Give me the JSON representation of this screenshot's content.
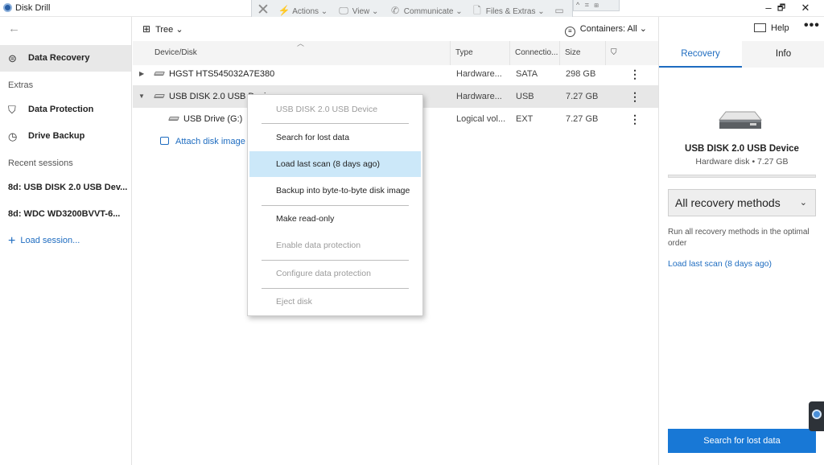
{
  "window": {
    "title": "Disk Drill",
    "controls": {
      "minimize": "–",
      "maximize": "🗗",
      "close": "✕"
    }
  },
  "remote_toolbar": {
    "items": [
      {
        "label": "Actions",
        "icon": "lightning-icon"
      },
      {
        "label": "View",
        "icon": "monitor-icon"
      },
      {
        "label": "Communicate",
        "icon": "phone-icon"
      },
      {
        "label": "Files & Extras",
        "icon": "files-icon"
      }
    ]
  },
  "sidebar": {
    "primary": {
      "label": "Data Recovery",
      "icon": "disk-icon"
    },
    "extras_label": "Extras",
    "extras": [
      {
        "label": "Data Protection",
        "icon": "shield-icon"
      },
      {
        "label": "Drive Backup",
        "icon": "clock-icon"
      }
    ],
    "recent_label": "Recent sessions",
    "sessions": [
      {
        "label": "8d: USB DISK 2.0 USB Dev..."
      },
      {
        "label": "8d: WDC WD3200BVVT-6..."
      }
    ],
    "load_session": "Load session..."
  },
  "toolbar": {
    "view_mode": "Tree",
    "containers": "Containers: All"
  },
  "table": {
    "columns": {
      "device": "Device/Disk",
      "type": "Type",
      "connection": "Connectio...",
      "size": "Size"
    },
    "rows": [
      {
        "name": "HGST HTS545032A7E380",
        "type": "Hardware...",
        "connection": "SATA",
        "size": "298 GB",
        "expanded": false
      },
      {
        "name": "USB DISK 2.0 USB Devi",
        "type": "Hardware...",
        "connection": "USB",
        "size": "7.27 GB",
        "expanded": true,
        "selected": true
      },
      {
        "name": "USB Drive (G:)",
        "type": "Logical vol...",
        "connection": "EXT",
        "size": "7.27 GB",
        "child": true
      }
    ],
    "attach_label": "Attach disk image"
  },
  "context_menu": {
    "header": "USB DISK 2.0 USB Device",
    "items": [
      {
        "label": "Search for lost data",
        "disabled": false
      },
      {
        "label": "Load last scan (8 days ago)",
        "disabled": false,
        "highlighted": true
      },
      {
        "label": "Backup into byte-to-byte disk image",
        "disabled": false
      },
      {
        "label": "Make read-only",
        "disabled": false
      },
      {
        "label": "Enable data protection",
        "disabled": true
      },
      {
        "label": "Configure data protection",
        "disabled": true
      },
      {
        "label": "Eject disk",
        "disabled": true
      }
    ]
  },
  "right_panel": {
    "help_label": "Help",
    "tabs": [
      {
        "label": "Recovery",
        "active": true
      },
      {
        "label": "Info",
        "active": false
      }
    ],
    "device_name": "USB DISK 2.0 USB Device",
    "device_sub": "Hardware disk • 7.27 GB",
    "method": "All recovery methods",
    "method_desc": "Run all recovery methods in the optimal order",
    "load_link": "Load last scan (8 days ago)",
    "search_button": "Search for lost data"
  },
  "colors": {
    "accent": "#1e6cc0",
    "button_bg": "#1878d6",
    "highlight": "#cce8f9"
  }
}
